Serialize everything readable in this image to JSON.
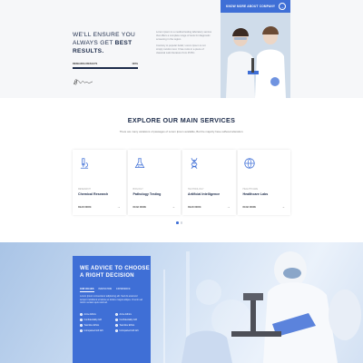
{
  "hero": {
    "title_line1": "WE'LL ENSURE YOU",
    "title_line2_regular": "ALWAYS GET ",
    "title_line2_bold": "BEST",
    "title_line3_bold": "RESULTS.",
    "progress_label": "RESEARCH RESULTS",
    "progress_value_text": "100%",
    "progress_fraction": 1.0,
    "paragraph1": "Lorem ipsum is a medical testing laboratory service that offers a complete range of tests for diagnostic screening in the region.",
    "paragraph2": "Contrary to popular belief, Lorem Ipsum is not simply random text. It has roots in a piece of classical Latin literature from 45 BC.",
    "cta_label": "KNOW MORE ABOUT COMPANY",
    "cta_arrow": "→"
  },
  "services": {
    "title_regular": "EXPLORE OUR ",
    "title_bold": "MAIN SERVICES",
    "subtitle": "There are many variations of passages of Lorem Ipsum available, But the majority have suffered alteration.",
    "cards": [
      {
        "icon": "microscope-icon",
        "category": "Research",
        "title": "Chemical Research",
        "readmore": "READ MORE",
        "arrow": "→"
      },
      {
        "icon": "flask-icon",
        "category": "Biology",
        "title": "Pathology Testing",
        "readmore": "READ MORE",
        "arrow": "→"
      },
      {
        "icon": "dna-icon",
        "category": "Technology",
        "title": "Artificial Intelligence",
        "readmore": "READ MORE",
        "arrow": "→"
      },
      {
        "icon": "globe-icon",
        "category": "Healthcare",
        "title": "Healthcare Labs",
        "readmore": "READ MORE",
        "arrow": "→"
      }
    ]
  },
  "advice": {
    "title_line1": "WE ADVICE TO CHOOSE",
    "title_line2": "A RIGHT DECISION",
    "tabs": [
      "OUR VALUES",
      "INNOVATION",
      "EXPERIENCE"
    ],
    "active_tab": 0,
    "text": "Lorem Ipsum consectetur adipiscing elit. Sed do eiusmod tempor incididunt ut labore et dolore magna aliqua. Ut enim ad minim veniam quis nostrud.",
    "items": [
      "Acme Ethics",
      "Acme Ethics",
      "Confidentiality Gift",
      "Confidentiality Gift",
      "Teamline Ethics",
      "Teamline Ethics",
      "Unimpaired Gift Gift",
      "Unimpaired Gift Gift"
    ]
  },
  "colors": {
    "accent": "#3f6fd6",
    "heading": "#1c2b4a"
  }
}
